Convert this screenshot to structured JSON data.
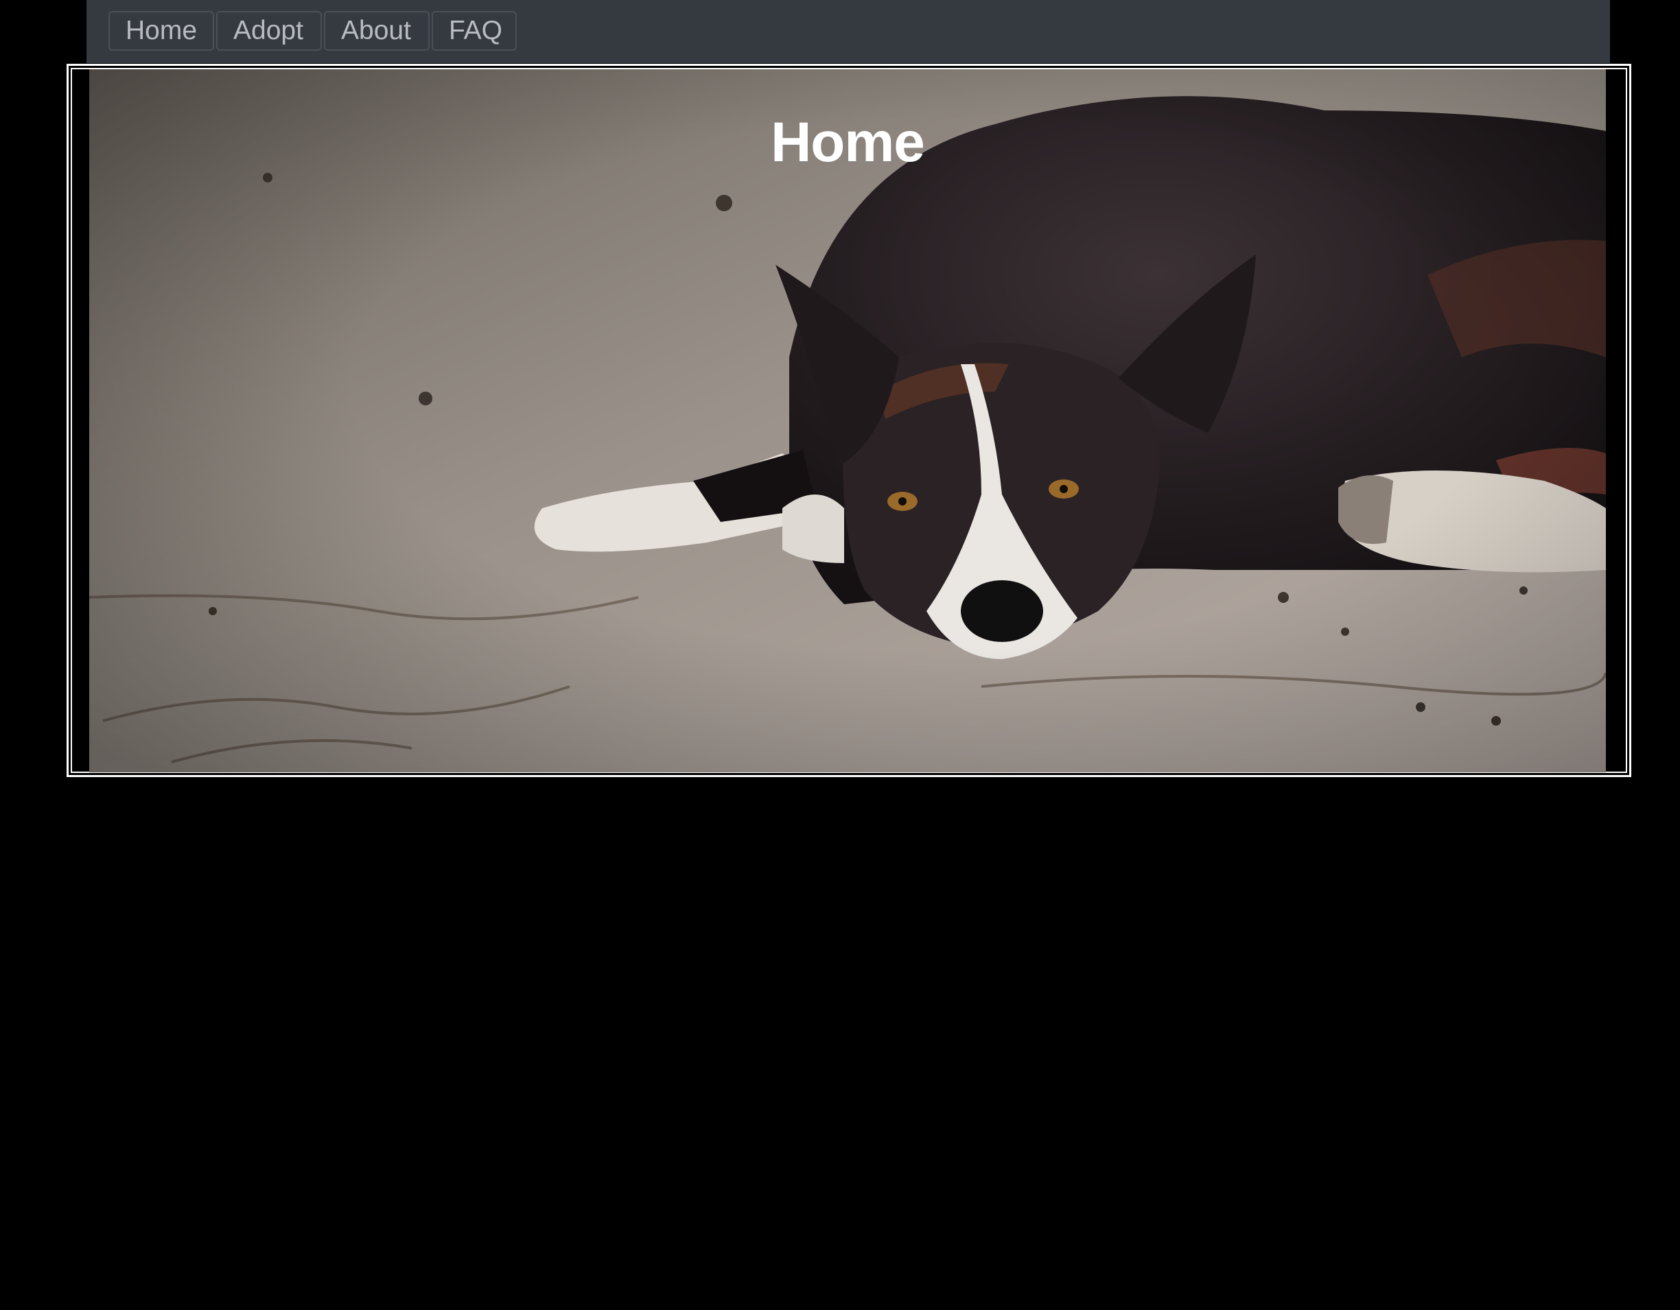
{
  "nav": {
    "items": [
      {
        "label": "Home"
      },
      {
        "label": "Adopt"
      },
      {
        "label": "About"
      },
      {
        "label": "FAQ"
      }
    ]
  },
  "hero": {
    "title": "Home",
    "image_subject": "black-and-white dog lying on pavement"
  },
  "colors": {
    "background": "#000000",
    "navbar": "#343a40",
    "nav_text": "#b8bcc0",
    "hero_border": "#ffffff",
    "title": "#ffffff"
  }
}
